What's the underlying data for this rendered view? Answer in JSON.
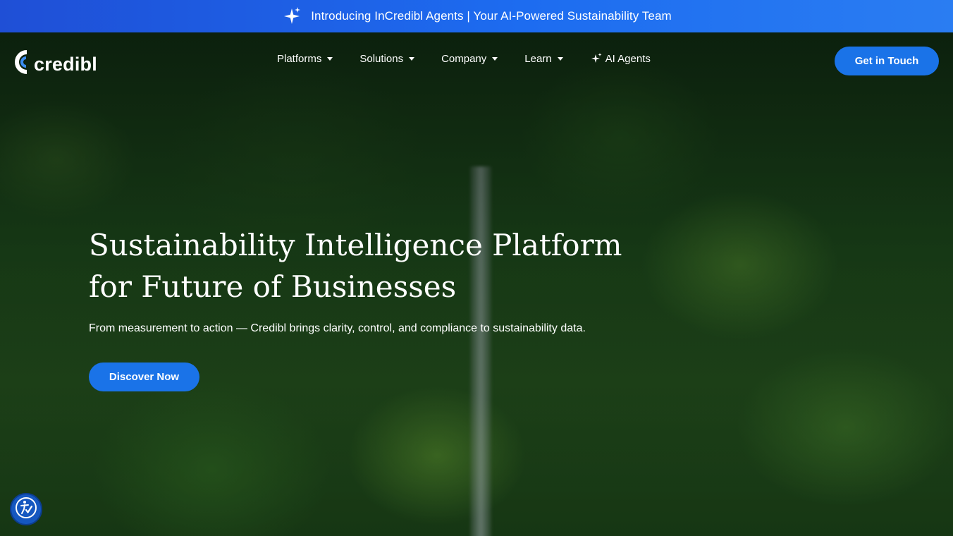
{
  "announcement": {
    "text": "Introducing InCredibl Agents | Your AI-Powered Sustainability Team",
    "icon": "sparkle-icon"
  },
  "brand": {
    "name": "credibl",
    "logo_icon": "credibl-logo-icon"
  },
  "nav": {
    "items": [
      {
        "label": "Platforms",
        "icon": "chevron-down-icon"
      },
      {
        "label": "Solutions",
        "icon": "chevron-down-icon"
      },
      {
        "label": "Company",
        "icon": "chevron-down-icon"
      },
      {
        "label": "Learn",
        "icon": "chevron-down-icon"
      },
      {
        "label": "AI Agents",
        "icon": "sparkle-icon"
      }
    ],
    "cta_label": "Get in Touch"
  },
  "hero": {
    "headline_line1": "Sustainability Intelligence Platform",
    "headline_line2": "for Future of Businesses",
    "subtitle": "From measurement to action — Credibl brings clarity, control, and compliance to sustainability data.",
    "cta_label": "Discover Now"
  },
  "accessibility_widget": {
    "icon": "accessibility-icon"
  },
  "colors": {
    "accent": "#1a73e8",
    "banner_start": "#1f4fd6",
    "banner_end": "#2a7df2",
    "text": "#ffffff"
  }
}
